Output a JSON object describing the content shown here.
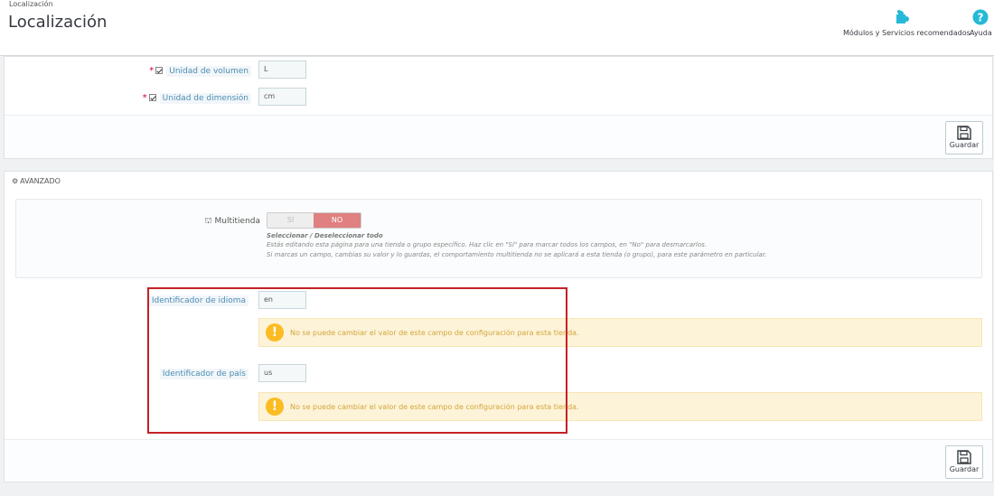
{
  "header": {
    "breadcrumb": "Localización",
    "title": "Localización",
    "modules_label": "Módulos y Servicios recomendados",
    "help_label": "Ayuda"
  },
  "units": {
    "volume_label": "Unidad de volumen",
    "volume_value": "L",
    "dimension_label": "Unidad de dimensión",
    "dimension_value": "cm",
    "required_mark": "*"
  },
  "save_label": "Guardar",
  "advanced": {
    "heading": "AVANZADO",
    "multistore_label": "Multitienda",
    "switch_yes": "SÍ",
    "switch_no": "NO",
    "help_title": "Seleccionar / Deseleccionar todo",
    "help_line1": "Estás editando esta página para una tienda o grupo específico. Haz clic en \"Sí\" para marcar todos los campos, en \"No\" para desmarcarlos.",
    "help_line2": "Si marcas un campo, cambias su valor y lo guardas, el comportamiento multitienda no se aplicará a esta tienda (o grupo), para este parámetro en particular.",
    "language_id_label": "Identificador de idioma",
    "language_id_value": "en",
    "country_id_label": "Identificador de país",
    "country_id_value": "us",
    "warning_text": "No se puede cambiar el valor de este campo de configuración para esta tienda."
  },
  "colors": {
    "label_blue": "#4b8db4",
    "switch_no_bg": "#e08080",
    "warning_bg": "#fdf3d8",
    "highlight_red": "#c42126",
    "icon_teal": "#25b9d7"
  }
}
